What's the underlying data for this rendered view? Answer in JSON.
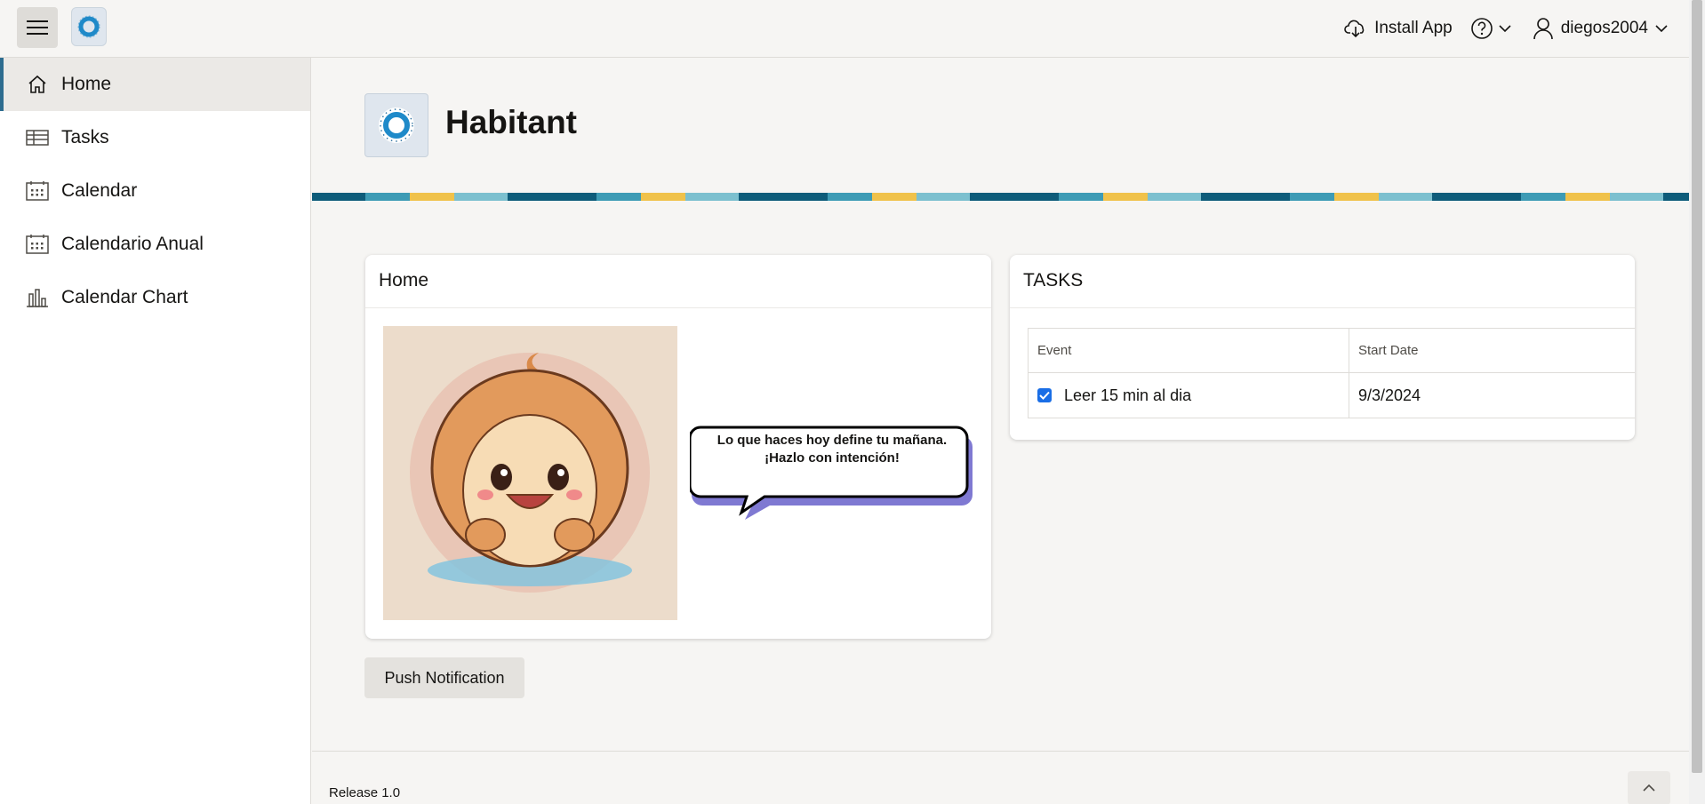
{
  "header": {
    "install_label": "Install App",
    "user_name": "diegos2004"
  },
  "sidebar": {
    "items": [
      {
        "label": "Home",
        "icon": "home-icon"
      },
      {
        "label": "Tasks",
        "icon": "table-icon"
      },
      {
        "label": "Calendar",
        "icon": "calendar-icon"
      },
      {
        "label": "Calendario Anual",
        "icon": "calendar-icon"
      },
      {
        "label": "Calendar Chart",
        "icon": "bar-chart-icon"
      }
    ]
  },
  "hero": {
    "title": "Habitant"
  },
  "home_card": {
    "title": "Home",
    "bubble_text": "Lo que haces hoy define tu mañana. ¡Hazlo con intención!"
  },
  "tasks_card": {
    "title": "TASKS",
    "columns": [
      "Event",
      "Start Date"
    ],
    "rows": [
      {
        "event": "Leer 15 min al dia",
        "start_date": "9/3/2024",
        "checked": true
      }
    ]
  },
  "actions": {
    "push_label": "Push Notification"
  },
  "footer": {
    "release": "Release 1.0"
  },
  "colors": {
    "accent": "#2d6c8f",
    "checkbox": "#1a6ee6"
  }
}
